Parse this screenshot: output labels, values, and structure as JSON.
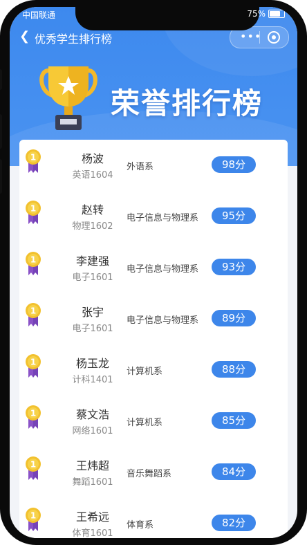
{
  "status": {
    "carrier": "中国联通",
    "battery": "75%",
    "battery_level": 0.75
  },
  "navbar": {
    "back_icon": "chevron-left-icon",
    "title": "优秀学生排行榜",
    "more_icon": "more-dots-icon",
    "close_icon": "mini-program-close-icon"
  },
  "banner": {
    "title": "荣誉排行榜",
    "icon": "trophy-icon"
  },
  "colors": {
    "primary": "#3d86ea",
    "medal_gold": "#f2c12e",
    "ribbon": "#8a52c7"
  },
  "ranking": [
    {
      "rank": "1",
      "name": "杨波",
      "class": "英语1604",
      "department": "外语系",
      "score": "98分"
    },
    {
      "rank": "1",
      "name": "赵转",
      "class": "物理1602",
      "department": "电子信息与物理系",
      "score": "95分"
    },
    {
      "rank": "1",
      "name": "李建强",
      "class": "电子1601",
      "department": "电子信息与物理系",
      "score": "93分"
    },
    {
      "rank": "1",
      "name": "张宇",
      "class": "电子1601",
      "department": "电子信息与物理系",
      "score": "89分"
    },
    {
      "rank": "1",
      "name": "杨玉龙",
      "class": "计科1401",
      "department": "计算机系",
      "score": "88分"
    },
    {
      "rank": "1",
      "name": "蔡文浩",
      "class": "网络1601",
      "department": "计算机系",
      "score": "85分"
    },
    {
      "rank": "1",
      "name": "王炜超",
      "class": "舞蹈1601",
      "department": "音乐舞蹈系",
      "score": "84分"
    },
    {
      "rank": "1",
      "name": "王希远",
      "class": "体育1601",
      "department": "体育系",
      "score": "82分"
    }
  ]
}
